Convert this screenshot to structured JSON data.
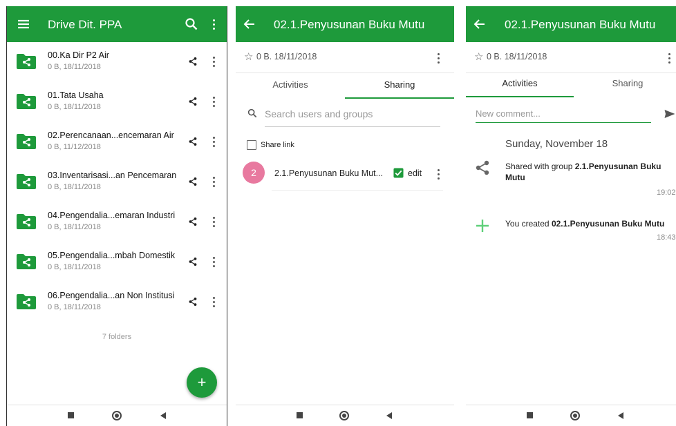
{
  "screen1": {
    "title": "Drive Dit. PPA",
    "folders": [
      {
        "name": "00.Ka Dir P2 Air",
        "meta": "0 B, 18/11/2018"
      },
      {
        "name": "01.Tata Usaha",
        "meta": "0 B, 18/11/2018"
      },
      {
        "name": "02.Perencanaan...encemaran Air",
        "meta": "0 B, 11/12/2018"
      },
      {
        "name": "03.Inventarisasi...an Pencemaran",
        "meta": "0 B, 18/11/2018"
      },
      {
        "name": "04.Pengendalia...emaran Industri",
        "meta": "0 B, 18/11/2018"
      },
      {
        "name": "05.Pengendalia...mbah Domestik",
        "meta": "0 B, 18/11/2018"
      },
      {
        "name": "06.Pengendalia...an Non Institusi",
        "meta": "0 B, 18/11/2018"
      }
    ],
    "footer": "7 folders",
    "fab_label": "+"
  },
  "screen2": {
    "title": "02.1.Penyusunan Buku Mutu",
    "info": "0 B. 18/11/2018",
    "tabs": [
      "Activities",
      "Sharing"
    ],
    "search_placeholder": "Search users and groups",
    "share_link_label": "Share link",
    "share": {
      "avatar": "2",
      "name": "2.1.Penyusunan Buku Mut...",
      "permission": "edit"
    }
  },
  "screen3": {
    "title": "02.1.Penyusunan Buku Mutu",
    "info": "0 B. 18/11/2018",
    "tabs": [
      "Activities",
      "Sharing"
    ],
    "comment_placeholder": "New comment...",
    "date_header": "Sunday, November 18",
    "activities": [
      {
        "prefix": "Shared with group ",
        "bold": "2.1.Penyusunan Buku Mutu",
        "time": "19:02"
      },
      {
        "prefix": "You created ",
        "bold": "02.1.Penyusunan Buku Mutu",
        "time": "18:43"
      }
    ]
  },
  "colors": {
    "accent": "#1e9a3b",
    "avatar": "#e8799f",
    "add_icon": "#5fd07a"
  },
  "icons": [
    "menu-icon",
    "search-icon",
    "more-vert-icon",
    "back-arrow-icon",
    "star-outline-icon",
    "share-icon",
    "folder-shared-icon",
    "checkbox-icon",
    "send-icon",
    "add-icon"
  ]
}
